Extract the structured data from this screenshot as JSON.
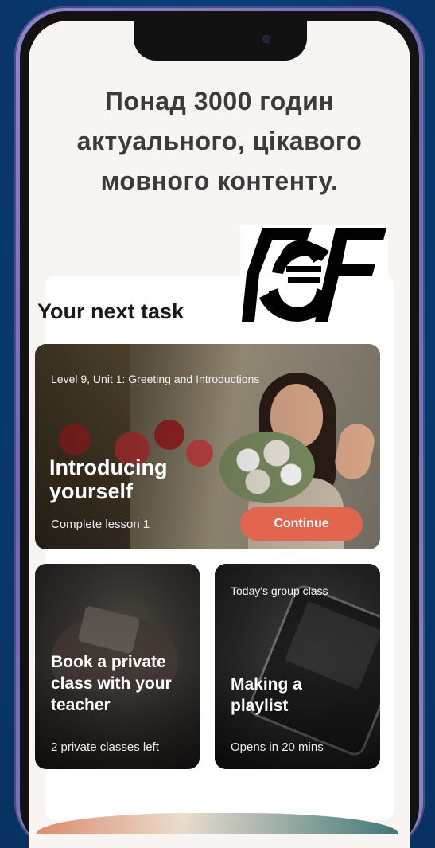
{
  "headline": {
    "line1": "Понад 3000 годин",
    "line2": "актуального, цікавого",
    "line3": "мовного контенту."
  },
  "logo": {
    "text": "EF"
  },
  "section": {
    "title": "Your next task"
  },
  "task_card": {
    "meta": "Level 9, Unit 1: Greeting and Introductions",
    "title": "Introducing yourself",
    "subtitle": "Complete lesson 1",
    "button_label": "Continue",
    "button_color": "#e2664d"
  },
  "private_class_card": {
    "title": "Book a private class with your teacher",
    "subtitle": "2 private classes left"
  },
  "group_class_card": {
    "tag": "Today's group class",
    "title": "Making a playlist",
    "subtitle": "Opens in 20 mins"
  },
  "colors": {
    "background": "#0b3e78",
    "phone_frame": "#8a83c4",
    "screen_bg": "#f7f4f1",
    "accent": "#e2664d"
  }
}
